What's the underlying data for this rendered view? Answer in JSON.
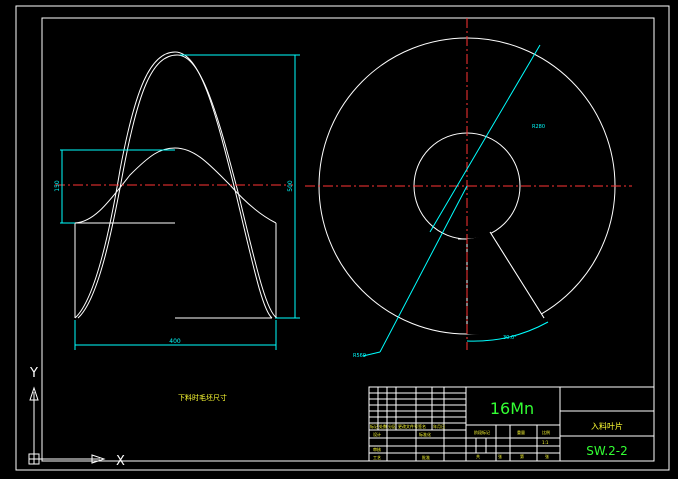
{
  "drawing": {
    "material": "16Mn",
    "drawing_number": "SW.2-2",
    "part_name": "入料叶片",
    "note": "下料时毛坯尺寸",
    "dims": {
      "width_bottom": "400",
      "height_right": "500",
      "height_left": "150",
      "radius_outer": "R569",
      "radius_inner": "R280",
      "angle": "30.0°"
    },
    "title_block": {
      "row_labels": [
        "标记",
        "处数",
        "分区",
        "更改文件号",
        "签名",
        "年月日"
      ],
      "left_labels": [
        "设计",
        "审核",
        "工艺"
      ],
      "bottom_labels": [
        "标准化",
        "批准"
      ],
      "mid_labels": [
        "阶段标记",
        "重量",
        "比例"
      ],
      "scale": "1:1",
      "sheet_labels": [
        "共",
        "张",
        "第",
        "张"
      ]
    }
  },
  "ucs": {
    "y_label": "Y",
    "x_label": "X"
  },
  "colors": {
    "background": "#000000",
    "geometry": "#ffffff",
    "dimension": "#00ffff",
    "centerline": "#ff3333",
    "text_green": "#33ff33",
    "text_yellow": "#ffff33"
  }
}
